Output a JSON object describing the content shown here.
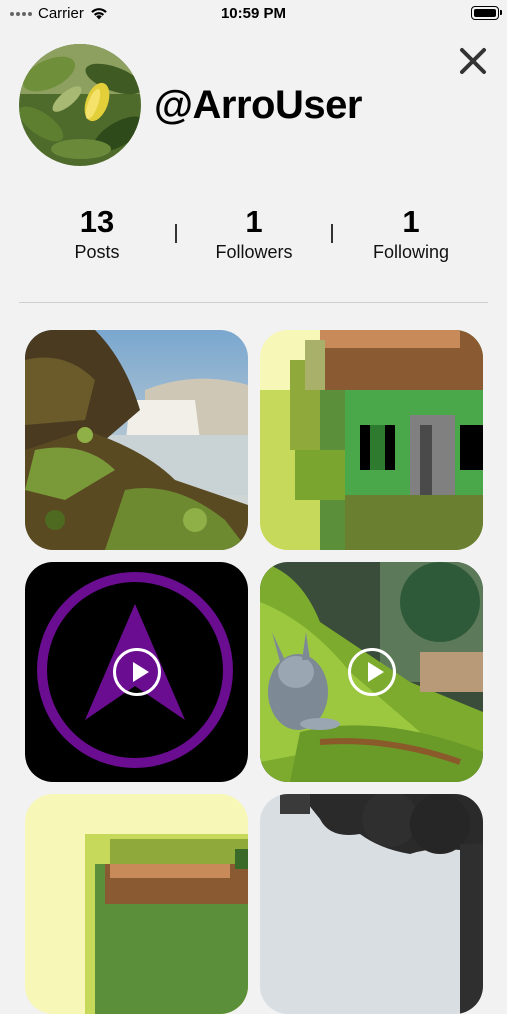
{
  "status_bar": {
    "carrier": "Carrier",
    "time": "10:59 PM"
  },
  "profile": {
    "username": "@ArroUser",
    "avatar_icon": "avatar-photo"
  },
  "stats": [
    {
      "value": "13",
      "label": "Posts"
    },
    {
      "value": "1",
      "label": "Followers"
    },
    {
      "value": "1",
      "label": "Following"
    }
  ],
  "grid": [
    {
      "kind": "photo",
      "subject": "waterfall",
      "video": false
    },
    {
      "kind": "photo",
      "subject": "pixel-art-house",
      "video": false
    },
    {
      "kind": "video",
      "subject": "arro-logo",
      "video": true
    },
    {
      "kind": "video",
      "subject": "rabbit-in-grass",
      "video": true
    },
    {
      "kind": "photo",
      "subject": "pixel-art-house",
      "video": false
    },
    {
      "kind": "photo",
      "subject": "tree",
      "video": false
    }
  ],
  "colors": {
    "background": "#f2f2f2",
    "accent_purple": "#6a0d91"
  }
}
